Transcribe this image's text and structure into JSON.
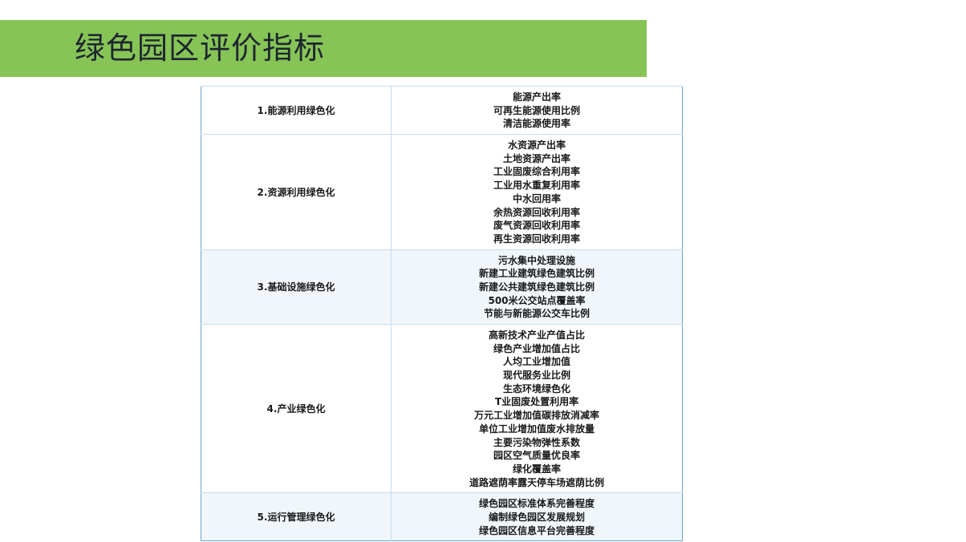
{
  "title": "绿色园区评价指标",
  "table": {
    "rows": [
      {
        "category": "1.能源利用绿色化",
        "items": [
          "能源产出率",
          "可再生能源使用比例",
          "清洁能源使用率"
        ]
      },
      {
        "category": "2.资源利用绿色化",
        "items": [
          "水资源产出率",
          "土地资源产出率",
          "工业固废综合利用率",
          "工业用水重复利用率",
          "中水回用率",
          "余热资源回收利用率",
          "废气资源回收利用率",
          "再生资源回收利用率"
        ]
      },
      {
        "category": "3.基础设施绿色化",
        "items": [
          "污水集中处理设施",
          "新建工业建筑绿色建筑比例",
          "新建公共建筑绿色建筑比例",
          "500米公交站点覆盖率",
          "节能与新能源公交车比例"
        ]
      },
      {
        "category": "4.产业绿色化",
        "items": [
          "高新技术产业产值占比",
          "绿色产业增加值占比",
          "人均工业增加值",
          "现代服务业比例",
          "生态环境绿色化",
          "T业固废处置利用率",
          "万元工业增加值碳排放消减率",
          "单位工业增加值废水排放量",
          "主要污染物弹性系数",
          "园区空气质量优良率",
          "绿化覆盖率",
          "道路遮荫率露天停车场遮荫比例"
        ]
      },
      {
        "category": "5.运行管理绿色化",
        "items": [
          "绿色园区标准体系完善程度",
          "编制绿色园区发展规划",
          "绿色园区信息平台完善程度"
        ]
      }
    ]
  }
}
